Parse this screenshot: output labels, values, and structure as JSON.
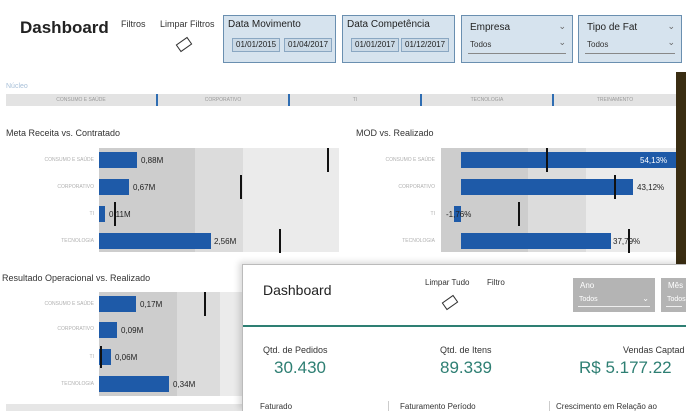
{
  "header": {
    "title": "Dashboard",
    "filtros": "Filtros",
    "limpar_filtros": "Limpar Filtros",
    "data_movimento": {
      "label": "Data Movimento",
      "from": "01/01/2015",
      "to": "01/04/2017"
    },
    "data_competencia": {
      "label": "Data Competência",
      "from": "01/01/2017",
      "to": "01/12/2017"
    },
    "empresa": {
      "label": "Empresa",
      "value": "Todos"
    },
    "tipo_fat": {
      "label": "Tipo de Fat",
      "value": "Todos"
    }
  },
  "tabs": {
    "faded_label": "Núcleo",
    "items": [
      "CONSUMO E SAÚDE",
      "CORPORATIVO",
      "TI",
      "TECNOLOGIA",
      "TREINAMENTO"
    ]
  },
  "charts": {
    "meta_receita": {
      "title": "Meta Receita vs. Contratado",
      "rows": [
        {
          "label": "CONSUMO E SAÚDE",
          "value_label": "0,88M"
        },
        {
          "label": "CORPORATIVO",
          "value_label": "0,67M"
        },
        {
          "label": "TI",
          "value_label": "0,11M"
        },
        {
          "label": "TECNOLOGIA",
          "value_label": "2,56M"
        }
      ]
    },
    "mod": {
      "title": "MOD vs. Realizado",
      "rows": [
        {
          "label": "CONSUMO E SAÚDE",
          "value_label": "54,13%"
        },
        {
          "label": "CORPORATIVO",
          "value_label": "43,12%"
        },
        {
          "label": "TI",
          "value_label": "-1,76%"
        },
        {
          "label": "TECNOLOGIA",
          "value_label": "37,79%"
        }
      ]
    },
    "resultado": {
      "title": "Resultado Operacional vs. Realizado",
      "rows": [
        {
          "label": "CONSUMO E SAÚDE",
          "value_label": "0,17M"
        },
        {
          "label": "CORPORATIVO",
          "value_label": "0,09M"
        },
        {
          "label": "TI",
          "value_label": "0,06M"
        },
        {
          "label": "TECNOLOGIA",
          "value_label": "0,34M"
        }
      ]
    }
  },
  "panel": {
    "title": "Dashboard",
    "limpar_tudo": "Limpar Tudo",
    "filtro": "Filtro",
    "ano": {
      "label": "Ano",
      "value": "Todos"
    },
    "mes": {
      "label": "Mês",
      "value": "Todos"
    },
    "kpis": [
      {
        "label": "Qtd. de Pedidos",
        "value": "30.430"
      },
      {
        "label": "Qtd. de Itens",
        "value": "89.339"
      },
      {
        "label": "Vendas Captad",
        "value": "R$ 5.177.22"
      }
    ],
    "footer": [
      "Faturado",
      "Faturamento Período",
      "Crescimento em Relação ao"
    ]
  },
  "colors": {
    "bar": "#1e5aa8",
    "teal": "#2e7f73",
    "slicer_bg": "#d6e3ee"
  }
}
